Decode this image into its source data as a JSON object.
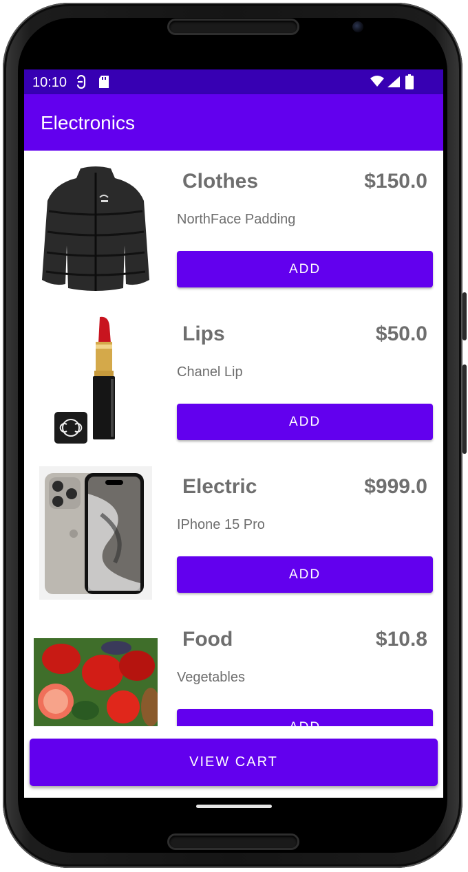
{
  "status_bar": {
    "time": "10:10",
    "left_icons": [
      "sync-data-icon",
      "sd-card-icon"
    ],
    "right_icons": [
      "wifi-icon",
      "signal-icon",
      "battery-icon"
    ]
  },
  "app_bar": {
    "title": "Electronics"
  },
  "products": [
    {
      "category": "Clothes",
      "price": "$150.0",
      "description": "NorthFace Padding",
      "button": "ADD",
      "image": "puffer-jacket-image"
    },
    {
      "category": "Lips",
      "price": "$50.0",
      "description": "Chanel Lip",
      "button": "ADD",
      "image": "lipstick-image"
    },
    {
      "category": "Electric",
      "price": "$999.0",
      "description": "IPhone 15 Pro",
      "button": "ADD",
      "image": "iphone-image"
    },
    {
      "category": "Food",
      "price": "$10.8",
      "description": "Vegetables",
      "button": "ADD",
      "image": "vegetables-image"
    }
  ],
  "view_cart_label": "VIEW CART",
  "colors": {
    "primary": "#6200ee",
    "primary_dark": "#3700b3",
    "text_secondary": "#6e6e6e"
  }
}
